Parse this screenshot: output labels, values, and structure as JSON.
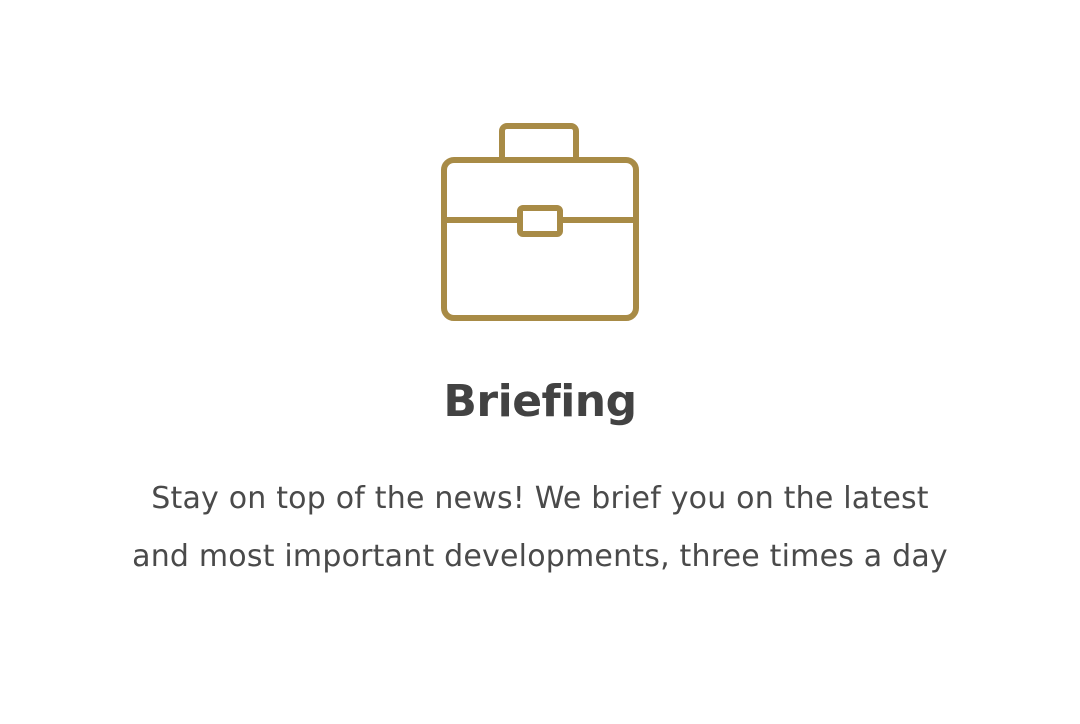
{
  "feature": {
    "icon": "briefcase-icon",
    "title": "Briefing",
    "description": "Stay on top of the news! We brief you on the latest and most important developments, three times a day"
  },
  "colors": {
    "icon_stroke": "#A88B46",
    "title_text": "#424242",
    "body_text": "#4A4A4A",
    "background": "#FFFFFF"
  }
}
